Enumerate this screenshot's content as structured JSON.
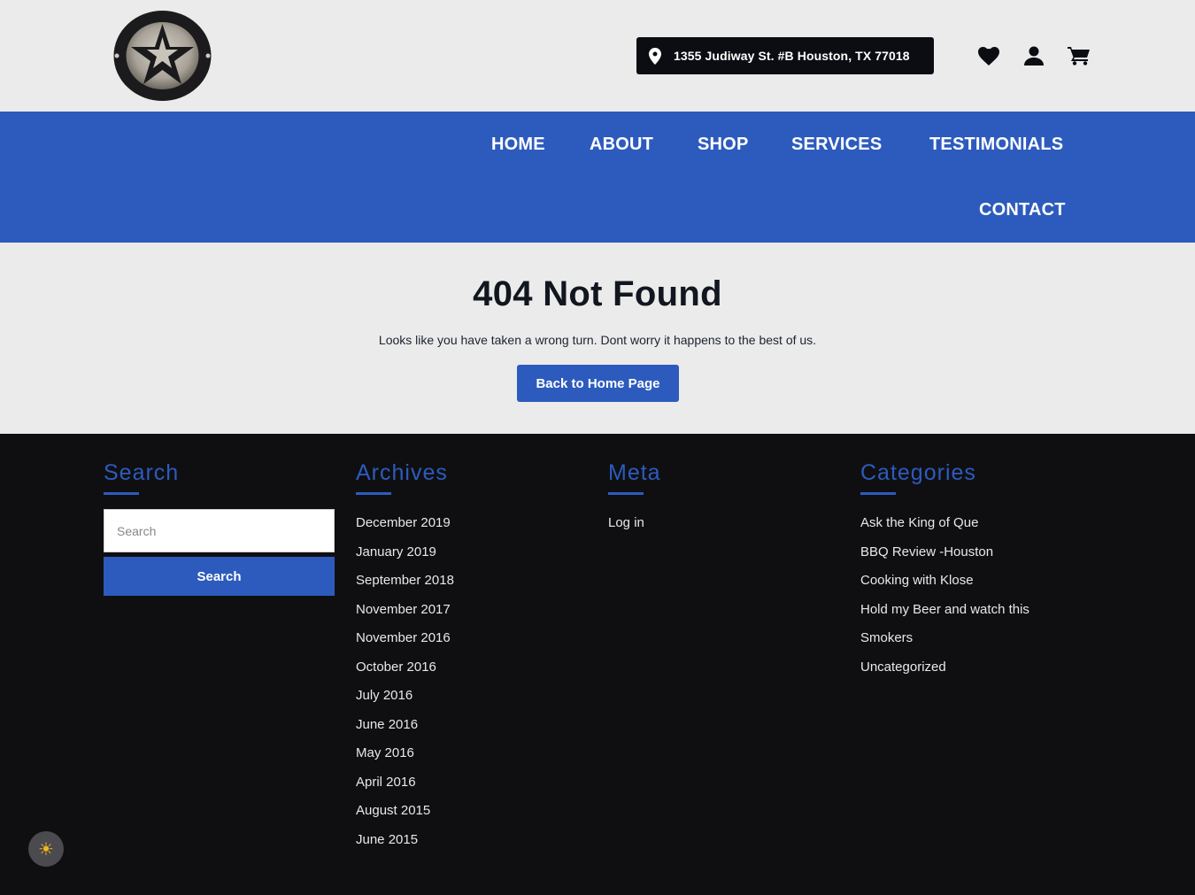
{
  "header": {
    "address": "1355 Judiway St. #B Houston, TX 77018",
    "icons": [
      "heart-icon",
      "user-icon",
      "cart-icon"
    ],
    "logo_icon": "bbq-pits-texas-star-logo"
  },
  "nav": {
    "items": [
      "HOME",
      "ABOUT",
      "SHOP",
      "SERVICES",
      "TESTIMONIALS",
      "CONTACT"
    ]
  },
  "main": {
    "title": "404 Not Found",
    "subtitle": "Looks like you have taken a wrong turn. Dont worry it happens to the best of us.",
    "back_button": "Back to Home Page"
  },
  "footer": {
    "search": {
      "title": "Search",
      "placeholder": "Search",
      "button": "Search"
    },
    "archives": {
      "title": "Archives",
      "items": [
        "December 2019",
        "January 2019",
        "September 2018",
        "November 2017",
        "November 2016",
        "October 2016",
        "July 2016",
        "June 2016",
        "May 2016",
        "April 2016",
        "August 2015",
        "June 2015"
      ]
    },
    "meta": {
      "title": "Meta",
      "items": [
        "Log in"
      ]
    },
    "categories": {
      "title": "Categories",
      "items": [
        "Ask the King of Que",
        "BBQ Review -Houston",
        "Cooking with Klose",
        "Hold my Beer and watch this",
        "Smokers",
        "Uncategorized"
      ]
    }
  },
  "colors": {
    "accent": "#2d5bbd",
    "dark": "#0f0f12",
    "light": "#ebebeb"
  },
  "theme_toggle_icon": "sun-icon"
}
